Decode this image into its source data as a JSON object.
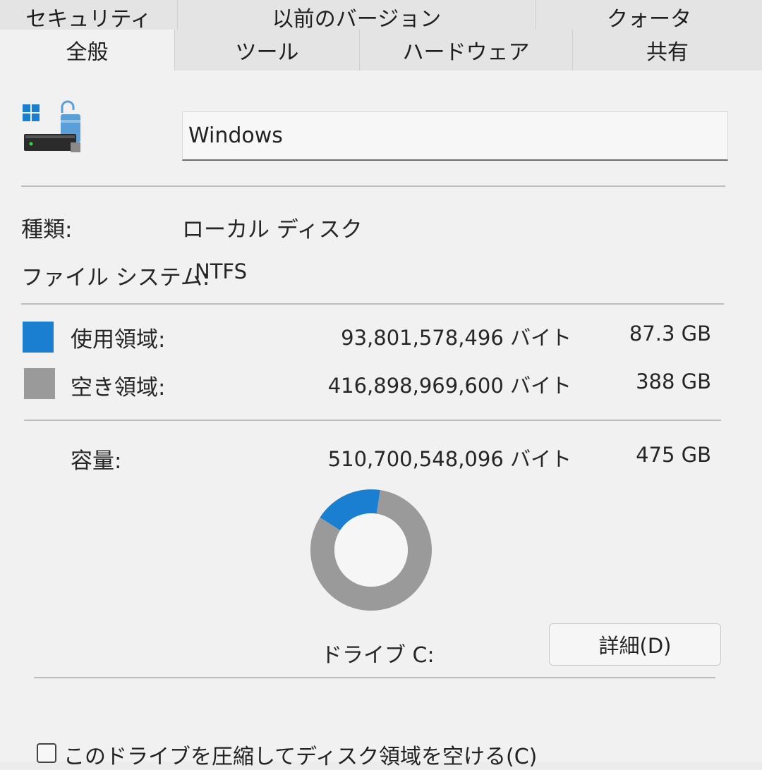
{
  "tabs_row1": [
    {
      "label": "セキュリティ"
    },
    {
      "label": "以前のバージョン"
    },
    {
      "label": "クォータ"
    }
  ],
  "tabs_row2": [
    {
      "label": "全般",
      "active": true
    },
    {
      "label": "ツール"
    },
    {
      "label": "ハードウェア"
    },
    {
      "label": "共有"
    }
  ],
  "drive": {
    "icon": "windows-drive-icon",
    "name_value": "Windows"
  },
  "info": {
    "type_label": "種類:",
    "type_value": "ローカル ディスク",
    "fs_label": "ファイル システム:",
    "fs_value": "NTFS"
  },
  "space": {
    "used_label": "使用領域:",
    "used_bytes": "93,801,578,496 バイト",
    "used_size": "87.3 GB",
    "used_color": "#1a7fd0",
    "free_label": "空き領域:",
    "free_bytes": "416,898,969,600 バイト",
    "free_size": "388 GB",
    "free_color": "#9a9a9a",
    "capacity_label": "容量:",
    "capacity_bytes": "510,700,548,096 バイト",
    "capacity_size": "475 GB"
  },
  "chart_data": {
    "type": "pie",
    "categories": [
      "使用領域",
      "空き領域"
    ],
    "values": [
      87.3,
      388
    ],
    "colors": [
      "#1a7fd0",
      "#9a9a9a"
    ]
  },
  "drive_label": "ドライブ C:",
  "details_button": "詳細(D)",
  "compress_checkbox": {
    "label": "このドライブを圧縮してディスク領域を空ける(C)",
    "checked": false
  }
}
